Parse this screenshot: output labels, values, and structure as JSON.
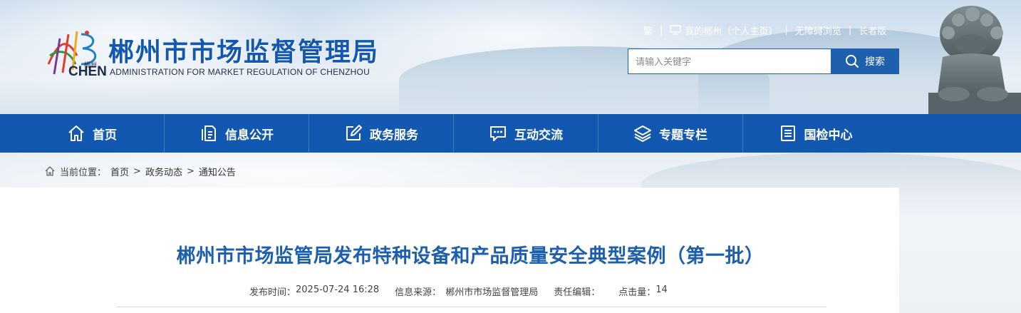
{
  "header": {
    "site_title": "郴州市市场监督管理局",
    "site_subtitle": "ADMINISTRATION FOR MARKET REGULATION OF CHENZHOU",
    "logo_text": "CHEN",
    "logo_text_cn": "郴州",
    "top_links": {
      "traditional": "繁",
      "my_chenzhou": "我的郴州（个人主页）",
      "accessible": "无障碍浏览",
      "elder": "长者版"
    },
    "search": {
      "placeholder": "请输入关键字",
      "button_label": "搜索"
    }
  },
  "nav": {
    "items": [
      {
        "label": "首页",
        "icon": "home-icon"
      },
      {
        "label": "信息公开",
        "icon": "document-icon"
      },
      {
        "label": "政务服务",
        "icon": "edit-icon"
      },
      {
        "label": "互动交流",
        "icon": "chat-icon"
      },
      {
        "label": "专题专栏",
        "icon": "layers-icon"
      },
      {
        "label": "国检中心",
        "icon": "list-icon"
      }
    ]
  },
  "breadcrumb": {
    "prefix": "当前位置：",
    "items": [
      "首页",
      "政务动态",
      "通知公告"
    ],
    "separator": ">"
  },
  "article": {
    "title": "郴州市市场监管局发布特种设备和产品质量安全典型案例（第一批）",
    "meta": {
      "publish_label": "发布时间：",
      "publish_time": "2025-07-24 16:28",
      "source_label": "信息来源：",
      "source": "郴州市市场监督管理局",
      "editor_label": "责任编辑：",
      "editor": "",
      "clicks_label": "点击量：",
      "clicks": "14"
    }
  },
  "colors": {
    "brand_blue": "#1258b0",
    "title_blue": "#1d5fad"
  }
}
